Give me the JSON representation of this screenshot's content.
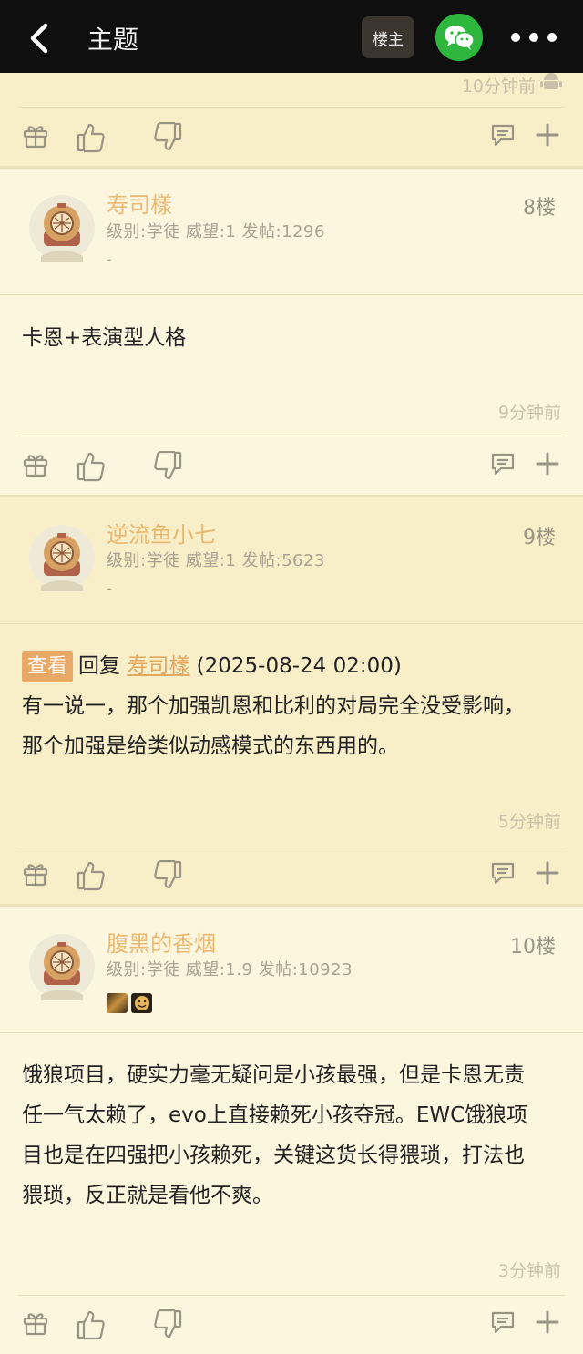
{
  "topbar": {
    "title": "主题",
    "owner_label": "楼主"
  },
  "top_time": "10分钟前",
  "posts": [
    {
      "username": "寿司樣",
      "floor": "8楼",
      "meta": "级别:学徒 威望:1 发帖:1296",
      "signature": "-",
      "content": "卡恩+表演型人格",
      "time": "9分钟前"
    },
    {
      "username": "逆流鱼小七",
      "floor": "9楼",
      "meta": "级别:学徒 威望:1 发帖:5623",
      "signature": "-",
      "reply_tag": "查看",
      "reply_prefix": "回复",
      "reply_user": "寿司樣",
      "reply_time": "(2025-08-24 02:00)",
      "content_line1": "有一说一，那个加强凯恩和比利的对局完全没受影响，",
      "content_line2": "那个加强是给类似动感模式的东西用的。",
      "time": "5分钟前"
    },
    {
      "username": "腹黑的香烟",
      "floor": "10楼",
      "meta": "级别:学徒 威望:1.9 发帖:10923",
      "content_line1": "饿狼项目，硬实力毫无疑问是小孩最强，但是卡恩无责",
      "content_line2": "任一气太赖了，evo上直接赖死小孩夺冠。EWC饿狼项",
      "content_line3": "目也是在四强把小孩赖死，关键这货长得猥琐，打法也",
      "content_line4": "猥琐，反正就是看他不爽。",
      "time": "3分钟前"
    }
  ],
  "colors": {
    "header_bg": "#0f0f0f",
    "page_bg": "#fdf6de",
    "header_band": "#f8eec8",
    "username": "#e9b872",
    "reply_tag_bg": "#e8a866",
    "wechat_green": "#2db83d"
  }
}
